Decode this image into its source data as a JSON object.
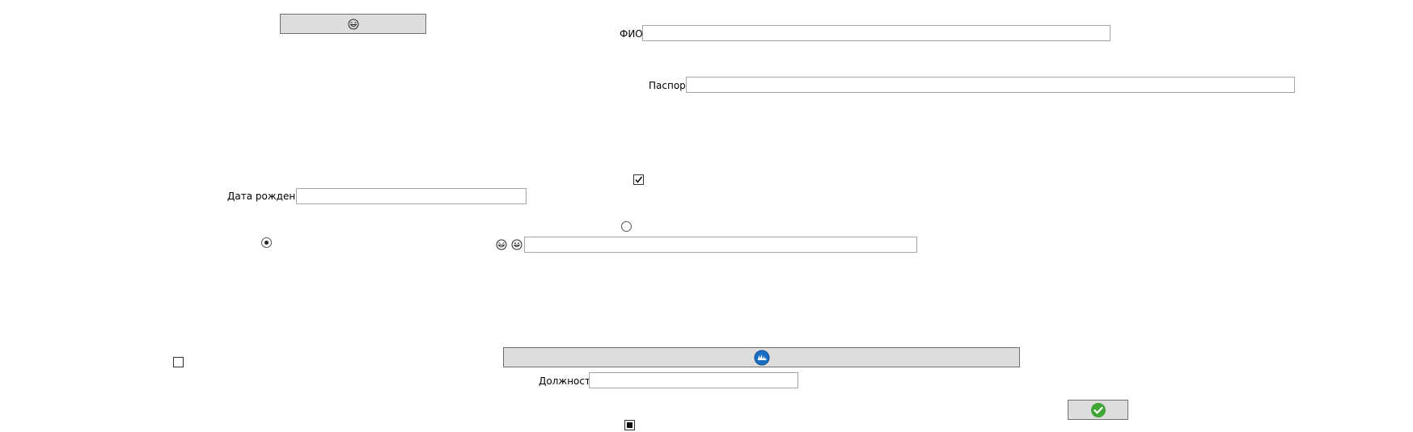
{
  "form": {
    "fio_label": "ФИО",
    "fio_value": "",
    "passport_label": "Паспорт",
    "passport_value": "",
    "birthdate_label": "Дата рождения",
    "birthdate_value": "",
    "emoji_field_value": "",
    "position_label": "Должность",
    "position_value": ""
  },
  "controls": {
    "checkbox_top": "checked",
    "checkbox_left": "unchecked",
    "checkbox_bottom": "indeterminate",
    "radio_top": "unselected",
    "radio_left": "selected"
  },
  "icons": {
    "top_button": "laughing-face-icon",
    "emoji_1": "laughing-face-icon",
    "emoji_2": "grinning-face-icon",
    "wide_button": "blue-globe-icon",
    "confirm_button": "green-check-icon"
  },
  "colors": {
    "button_bg": "#dddddd",
    "globe_blue": "#1a6fc4",
    "check_green": "#3fa535"
  }
}
